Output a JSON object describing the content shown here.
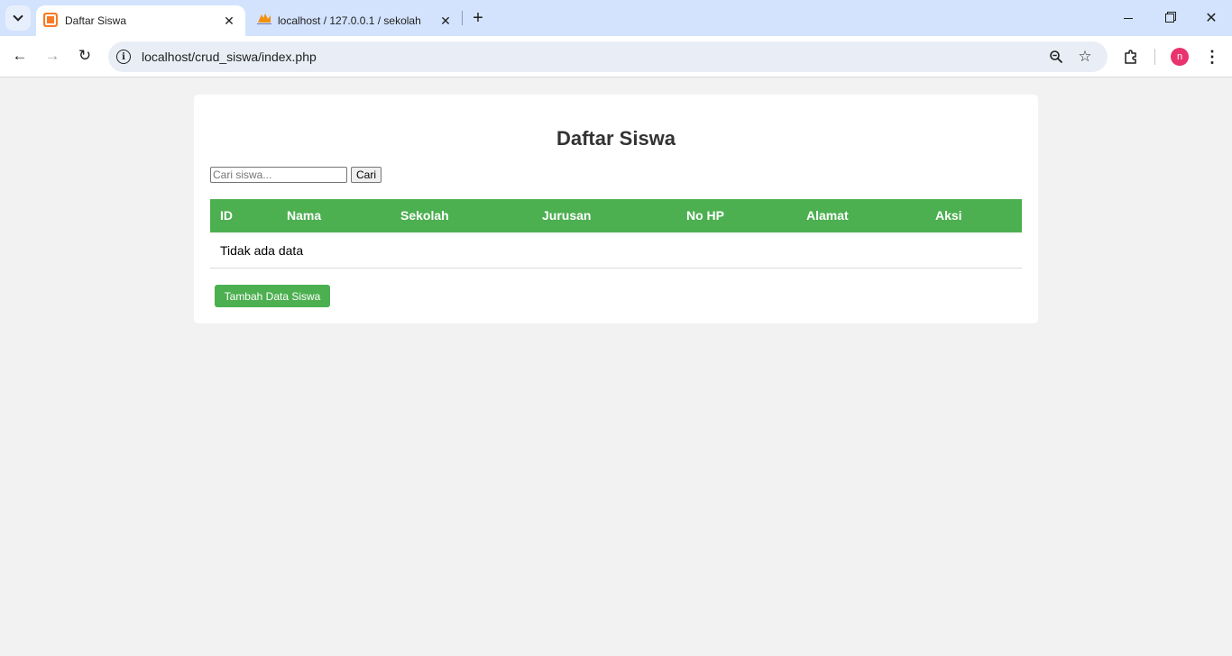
{
  "browser": {
    "tabs": [
      {
        "title": "Daftar Siswa",
        "active": true,
        "favicon": "xampp-icon"
      },
      {
        "title": "localhost / 127.0.0.1 / sekolah /",
        "active": false,
        "favicon": "phpmyadmin-icon"
      }
    ],
    "address": "localhost/crud_siswa/index.php",
    "profile_initial": "n",
    "profile_color": "#e8336f",
    "tabstrip_color": "#d3e3fd"
  },
  "page": {
    "title": "Daftar Siswa",
    "search": {
      "placeholder": "Cari siswa...",
      "value": "",
      "button_label": "Cari"
    },
    "table": {
      "columns": [
        "ID",
        "Nama",
        "Sekolah",
        "Jurusan",
        "No HP",
        "Alamat",
        "Aksi"
      ],
      "rows": [],
      "empty_message": "Tidak ada data"
    },
    "add_button_label": "Tambah Data Siswa",
    "accent_color": "#4caf50"
  }
}
